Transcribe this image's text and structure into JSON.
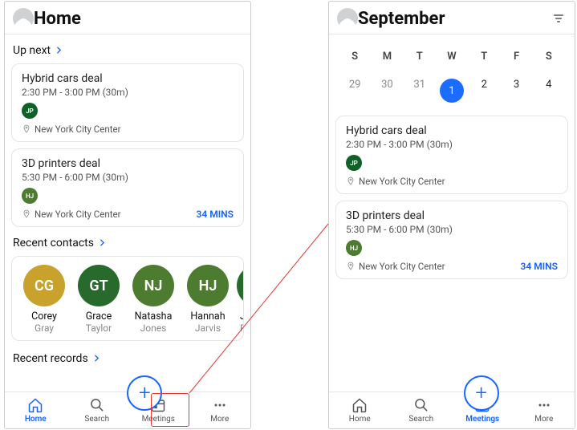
{
  "left": {
    "title": "Home",
    "up_next_label": "Up next",
    "meetings": [
      {
        "title": "Hybrid cars deal",
        "time": "2:30 PM - 3:00 PM (30m)",
        "badge": "JP",
        "badge_bg": "#0f6128",
        "loc": "New York City Center",
        "mins": ""
      },
      {
        "title": "3D printers deal",
        "time": "5:30 PM - 6:00 PM (30m)",
        "badge": "HJ",
        "badge_bg": "#4d7b2f",
        "loc": "New York City Center",
        "mins": "34 MINS"
      }
    ],
    "recent_contacts_label": "Recent contacts",
    "contacts": [
      {
        "initials": "CG",
        "bg": "#c8a22a",
        "first": "Corey",
        "last": "Gray"
      },
      {
        "initials": "GT",
        "bg": "#276a2b",
        "first": "Grace",
        "last": "Taylor"
      },
      {
        "initials": "NJ",
        "bg": "#4d7b2f",
        "first": "Natasha",
        "last": "Jones"
      },
      {
        "initials": "HJ",
        "bg": "#4d7b2f",
        "first": "Hannah",
        "last": "Jarvis"
      },
      {
        "initials": "J",
        "bg": "#276a2b",
        "first": "Jo",
        "last": "P"
      }
    ],
    "recent_records_label": "Recent records",
    "tabs": {
      "home": "Home",
      "search": "Search",
      "meetings": "Meetings",
      "more": "More"
    }
  },
  "right": {
    "title": "September",
    "dow": [
      "S",
      "M",
      "T",
      "W",
      "T",
      "F",
      "S"
    ],
    "days": [
      {
        "d": "29",
        "muted": true
      },
      {
        "d": "30",
        "muted": true
      },
      {
        "d": "31",
        "muted": true
      },
      {
        "d": "1",
        "sel": true
      },
      {
        "d": "2"
      },
      {
        "d": "3"
      },
      {
        "d": "4"
      }
    ],
    "meetings": [
      {
        "title": "Hybrid cars deal",
        "time": "2:30 PM - 3:00 PM (30m)",
        "badge": "JP",
        "badge_bg": "#0f6128",
        "loc": "New York City Center",
        "mins": ""
      },
      {
        "title": "3D printers deal",
        "time": "5:30 PM - 6:00 PM (30m)",
        "badge": "HJ",
        "badge_bg": "#4d7b2f",
        "loc": "New York City Center",
        "mins": "34 MINS"
      }
    ],
    "tabs": {
      "home": "Home",
      "search": "Search",
      "meetings": "Meetings",
      "more": "More"
    }
  }
}
